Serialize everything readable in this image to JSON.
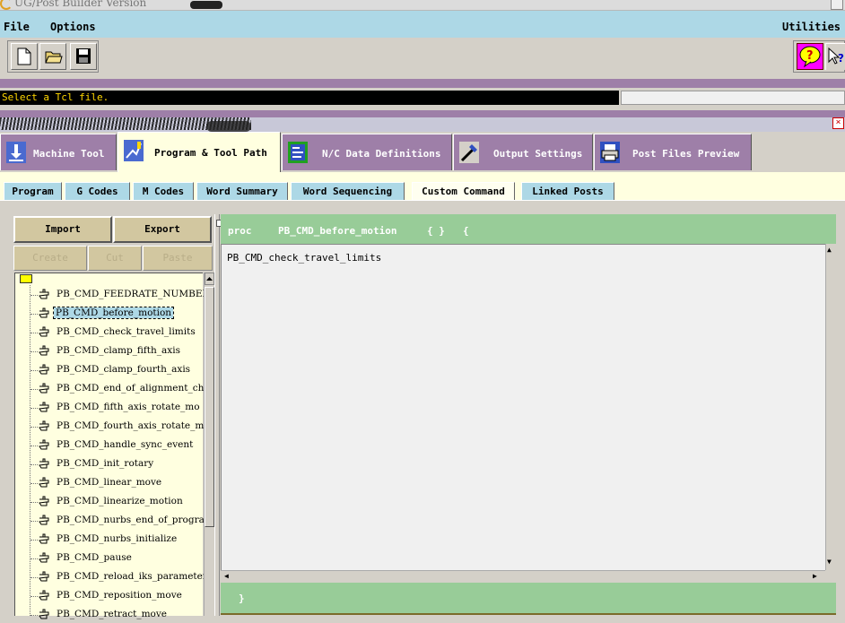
{
  "window": {
    "title": "UG/Post Builder Version"
  },
  "menubar": {
    "file": "File",
    "options": "Options",
    "utilities": "Utilities"
  },
  "toolbar": {
    "new_icon": "new-file-icon",
    "open_icon": "open-folder-icon",
    "save_icon": "save-disk-icon",
    "help_icon": "help-balloon-icon",
    "whats_this_icon": "whats-this-pointer-icon"
  },
  "status": {
    "message": "Select a Tcl file."
  },
  "main_tabs": [
    {
      "label": "Machine Tool",
      "icon": "machine-tool-icon"
    },
    {
      "label": "Program & Tool Path",
      "icon": "tool-path-icon",
      "active": true
    },
    {
      "label": "N/C Data Definitions",
      "icon": "nc-data-icon"
    },
    {
      "label": "Output Settings",
      "icon": "output-settings-icon"
    },
    {
      "label": "Post Files Preview",
      "icon": "printer-icon"
    }
  ],
  "sub_tabs": [
    {
      "label": "Program"
    },
    {
      "label": "G Codes"
    },
    {
      "label": "M Codes"
    },
    {
      "label": "Word Summary"
    },
    {
      "label": "Word Sequencing"
    },
    {
      "label": "Custom Command",
      "active": true
    },
    {
      "label": "Linked Posts"
    }
  ],
  "left_panel": {
    "import_label": "Import",
    "export_label": "Export",
    "create_label": "Create",
    "cut_label": "Cut",
    "paste_label": "Paste",
    "selected_index": 1,
    "items": [
      "PB_CMD_FEEDRATE_NUMBER",
      "PB_CMD_before_motion",
      "PB_CMD_check_travel_limits",
      "PB_CMD_clamp_fifth_axis",
      "PB_CMD_clamp_fourth_axis",
      "PB_CMD_end_of_alignment_cha",
      "PB_CMD_fifth_axis_rotate_mo",
      "PB_CMD_fourth_axis_rotate_m",
      "PB_CMD_handle_sync_event",
      "PB_CMD_init_rotary",
      "PB_CMD_linear_move",
      "PB_CMD_linearize_motion",
      "PB_CMD_nurbs_end_of_program",
      "PB_CMD_nurbs_initialize",
      "PB_CMD_pause",
      "PB_CMD_reload_iks_parameter",
      "PB_CMD_reposition_move",
      "PB_CMD_retract_move"
    ]
  },
  "editor": {
    "proc_keyword": "proc",
    "proc_name": "PB_CMD_before_motion",
    "proc_args": "{ }",
    "open_brace": "{",
    "body": "PB_CMD_check_travel_limits",
    "close_brace": "}"
  },
  "colors": {
    "menubar": "#add8e6",
    "purple": "#9e7fa8",
    "active_tab": "#ffffe0",
    "proc_green": "#98cc98",
    "status_text": "#ffd700"
  }
}
